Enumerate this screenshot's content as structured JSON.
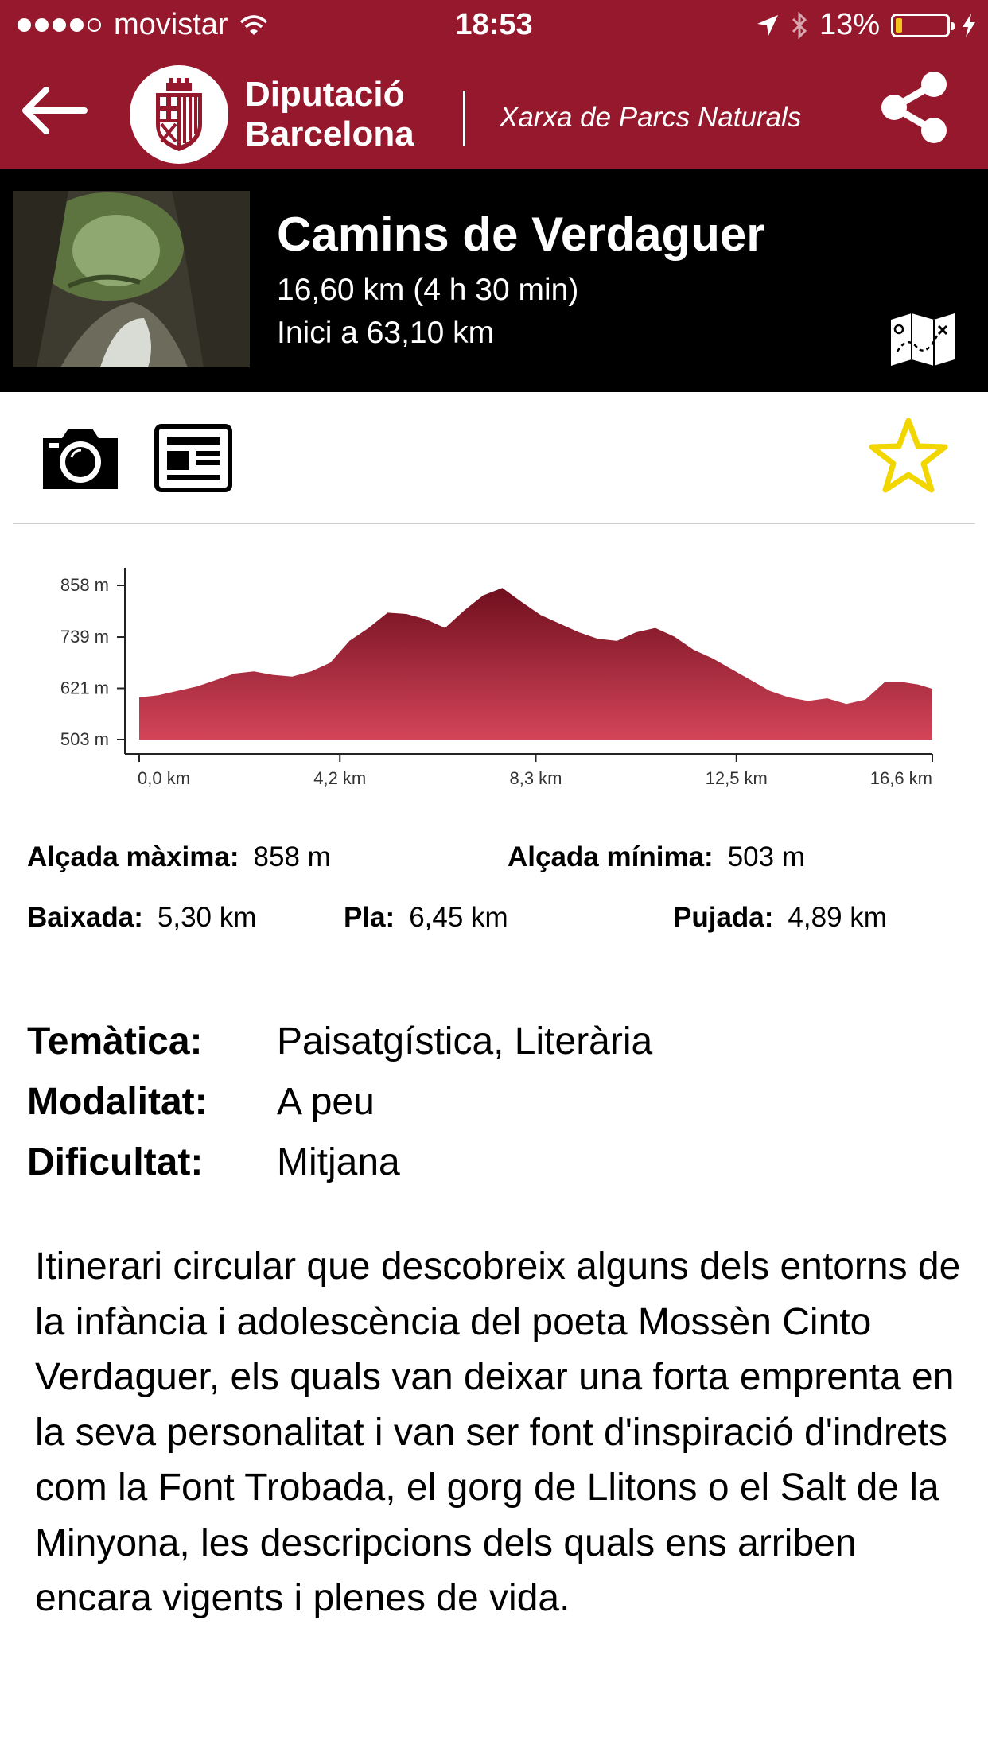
{
  "status_bar": {
    "carrier": "movistar",
    "signal_bars": 4,
    "time": "18:53",
    "battery": "13%",
    "battery_level": 0.13,
    "icons": [
      "wifi-icon",
      "location-arrow-icon",
      "bluetooth-icon",
      "charging-bolt-icon"
    ]
  },
  "nav": {
    "brand_line1": "Diputació",
    "brand_line2": "Barcelona",
    "subtitle": "Xarxa de Parcs Naturals",
    "icons": [
      "back-arrow-icon",
      "diputacio-logo",
      "share-icon"
    ]
  },
  "route": {
    "title": "Camins de Verdaguer",
    "distance": "16,60 km (4 h 30 min)",
    "start": "Inici a 63,10 km",
    "icons": [
      "route-thumbnail",
      "map-icon"
    ]
  },
  "toolbar": {
    "icons": [
      "camera-icon",
      "news-icon",
      "star-icon"
    ],
    "star_color": "#f2d600"
  },
  "chart_data": {
    "type": "area",
    "title": "",
    "xlabel": "",
    "ylabel": "",
    "x_ticks": [
      "0,0 km",
      "4,2 km",
      "8,3 km",
      "12,5 km",
      "16,6 km"
    ],
    "y_ticks": [
      "503 m",
      "621 m",
      "739 m",
      "858 m"
    ],
    "x_unit": "km",
    "y_unit": "m",
    "xlim": [
      0,
      16.6
    ],
    "ylim": [
      503,
      858
    ],
    "grid": false,
    "color_top": "#6f0f1e",
    "color_bottom": "#d44459",
    "x": [
      0.0,
      0.4,
      0.8,
      1.2,
      1.6,
      2.0,
      2.4,
      2.8,
      3.2,
      3.6,
      4.0,
      4.4,
      4.8,
      5.2,
      5.6,
      6.0,
      6.4,
      6.8,
      7.2,
      7.6,
      8.0,
      8.4,
      8.8,
      9.2,
      9.6,
      10.0,
      10.4,
      10.8,
      11.2,
      11.6,
      12.0,
      12.4,
      12.8,
      13.2,
      13.6,
      14.0,
      14.4,
      14.8,
      15.2,
      15.6,
      16.0,
      16.3,
      16.6
    ],
    "y": [
      600,
      605,
      615,
      625,
      640,
      655,
      660,
      652,
      648,
      660,
      680,
      730,
      760,
      795,
      792,
      780,
      760,
      800,
      835,
      852,
      820,
      790,
      770,
      750,
      735,
      730,
      750,
      760,
      740,
      710,
      690,
      665,
      640,
      615,
      600,
      592,
      598,
      585,
      595,
      635,
      635,
      630,
      620
    ]
  },
  "stats": {
    "max_label": "Alçada màxima:",
    "max_value": "858 m",
    "min_label": "Alçada mínima:",
    "min_value": "503 m",
    "down_label": "Baixada:",
    "down_value": "5,30 km",
    "flat_label": "Pla:",
    "flat_value": "6,45 km",
    "up_label": "Pujada:",
    "up_value": "4,89 km"
  },
  "props": {
    "theme_label": "Temàtica:",
    "theme_value": "Paisatgística, Literària",
    "mode_label": "Modalitat:",
    "mode_value": "A peu",
    "difficulty_label": "Dificultat:",
    "difficulty_value": "Mitjana"
  },
  "description": "Itinerari circular que descobreix alguns dels entorns de la infància i adolescència del poeta Mossèn Cinto Verdaguer, els quals van deixar una forta emprenta en la seva personalitat i van ser font d'inspiració d'indrets com la Font Trobada, el gorg de Llitons o el Salt de la Minyona, les descripcions dels quals ens arriben encara vigents i plenes de vida."
}
